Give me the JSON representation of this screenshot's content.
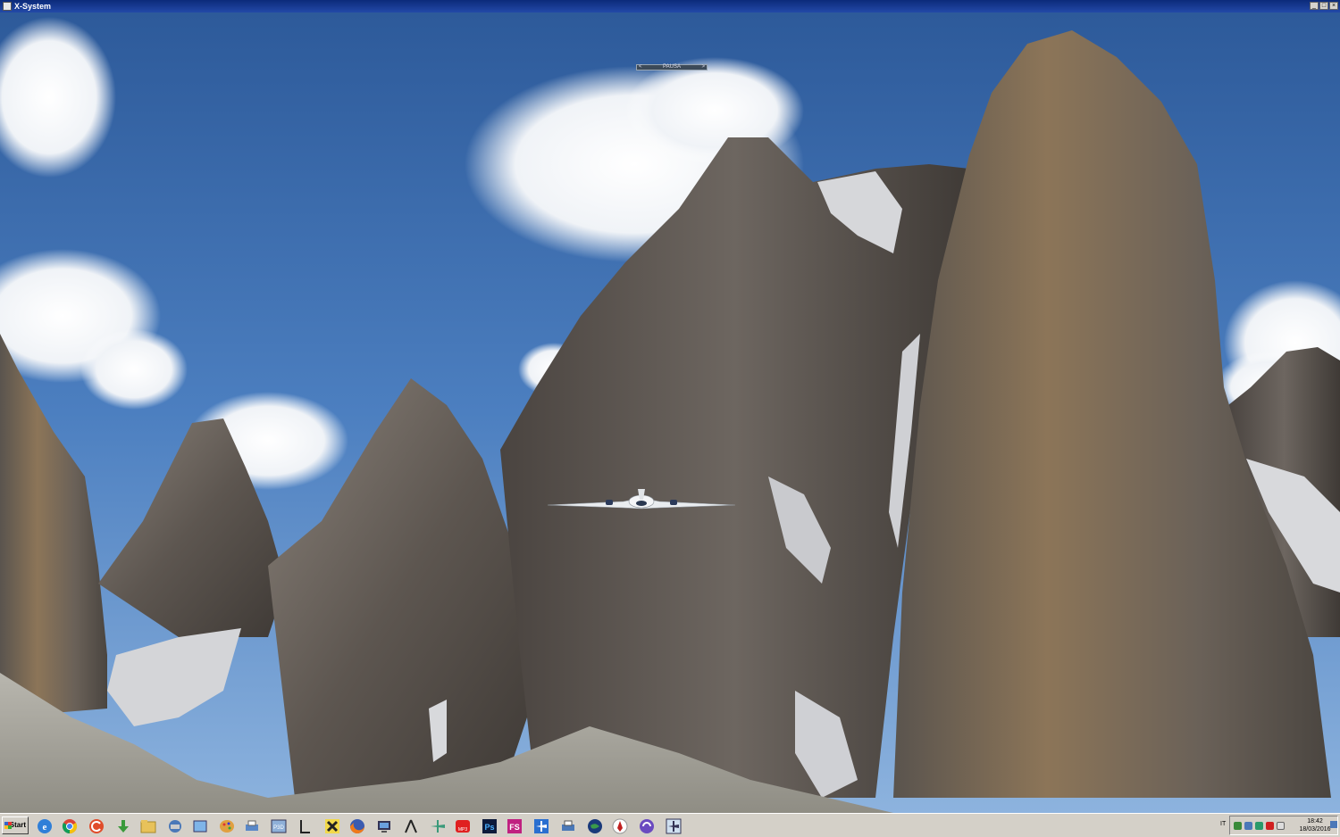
{
  "window": {
    "title": "X-System"
  },
  "sim": {
    "pause_label": "PAUSA"
  },
  "taskbar": {
    "start_label": "Start",
    "icons": [
      "internet-explorer-icon",
      "chrome-icon",
      "ccleaner-icon",
      "download-icon",
      "folder-icon",
      "network-icon",
      "window-icon",
      "palette-icon",
      "cloud-printer-icon",
      "p3d-icon",
      "text-icon",
      "x-plane-icon",
      "firefox-icon",
      "computer-icon",
      "compass-icon",
      "plane-tool-icon",
      "youtube-mp3-icon",
      "photoshop-icon",
      "fs-icon",
      "plane-icon",
      "printer-icon",
      "globe-icon",
      "ink-icon",
      "wave-icon",
      "plane-window-icon"
    ],
    "p3d_label": "P3D",
    "fs_label": "FS",
    "ps_label": "Ps",
    "mp3_label": "MP3",
    "tray": {
      "language": "IT",
      "time": "18:42",
      "date": "18/03/2016"
    }
  },
  "colors": {
    "sky_top": "#2f5d9e",
    "sky_bottom": "#6f9fd4",
    "rock": "#6b6560",
    "taskbar": "#d4d0c8"
  }
}
